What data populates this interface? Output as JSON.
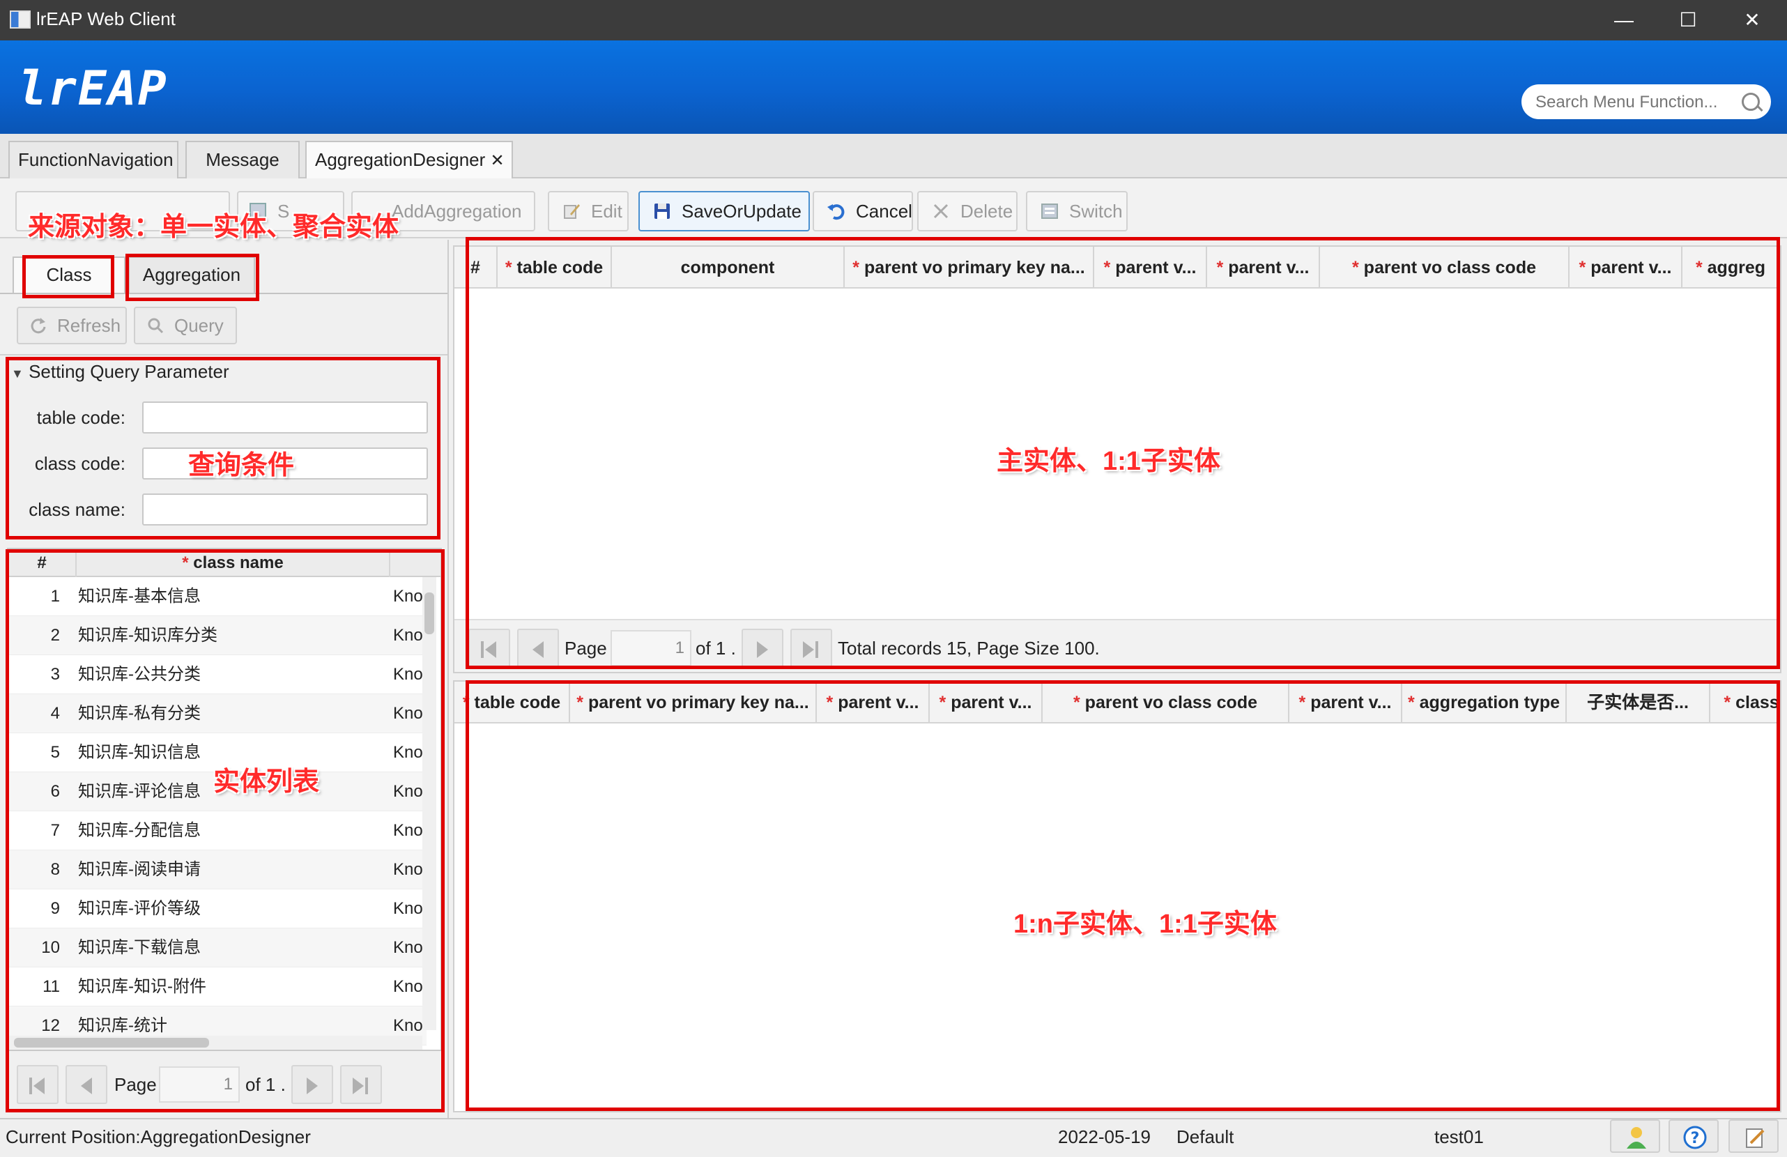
{
  "window": {
    "title": "lrEAP Web Client"
  },
  "header": {
    "logo": "lrEAP",
    "search_placeholder": "Search Menu Function..."
  },
  "main_tabs": [
    {
      "label": "FunctionNavigation"
    },
    {
      "label": "Message"
    },
    {
      "label": "AggregationDesigner",
      "close": "✕"
    }
  ],
  "toolbar": {
    "buttons": [
      {
        "label": "AddAggregation",
        "icon": "add-icon"
      },
      {
        "label": "Edit",
        "icon": "edit-icon"
      },
      {
        "label": "SaveOrUpdate",
        "icon": "save-icon"
      },
      {
        "label": "Cancel",
        "icon": "undo-icon"
      },
      {
        "label": "Delete",
        "icon": "delete-icon"
      },
      {
        "label": "Switch",
        "icon": "switch-icon"
      }
    ],
    "partial_label": "S"
  },
  "left": {
    "tabs": [
      "Class",
      "Aggregation"
    ],
    "refresh": "Refresh",
    "query": "Query",
    "query_title": "Setting Query Parameter",
    "fields": [
      {
        "label": "table code:",
        "value": ""
      },
      {
        "label": "class code:",
        "value": ""
      },
      {
        "label": "class name:",
        "value": ""
      }
    ],
    "table": {
      "headers": [
        "#",
        "class name"
      ],
      "rows": [
        {
          "n": "1",
          "name": "知识库-基本信息",
          "code": "Kno"
        },
        {
          "n": "2",
          "name": "知识库-知识库分类",
          "code": "Kno"
        },
        {
          "n": "3",
          "name": "知识库-公共分类",
          "code": "Kno"
        },
        {
          "n": "4",
          "name": "知识库-私有分类",
          "code": "Kno"
        },
        {
          "n": "5",
          "name": "知识库-知识信息",
          "code": "Kno"
        },
        {
          "n": "6",
          "name": "知识库-评论信息",
          "code": "Kno"
        },
        {
          "n": "7",
          "name": "知识库-分配信息",
          "code": "Kno"
        },
        {
          "n": "8",
          "name": "知识库-阅读申请",
          "code": "Kno"
        },
        {
          "n": "9",
          "name": "知识库-评价等级",
          "code": "Kno"
        },
        {
          "n": "10",
          "name": "知识库-下载信息",
          "code": "Kno"
        },
        {
          "n": "11",
          "name": "知识库-知识-附件",
          "code": "Kno"
        },
        {
          "n": "12",
          "name": "知识库-统计",
          "code": "Kno"
        }
      ]
    },
    "pager": {
      "page_label": "Page",
      "page_value": "1",
      "of_label": "of 1 ."
    }
  },
  "top_grid": {
    "headers": [
      "#",
      "* table code",
      "component",
      "* parent vo primary key na...",
      "* parent v...",
      "* parent v...",
      "* parent vo class code",
      "* parent v...",
      "* aggreg"
    ],
    "pager": {
      "page_label": "Page",
      "page_value": "1",
      "of_label": "of 1 .",
      "total": "Total records  15, Page Size 100."
    }
  },
  "bottom_grid": {
    "headers": [
      "* table code",
      "* parent vo primary key na...",
      "* parent v...",
      "* parent v...",
      "* parent vo class code",
      "* parent v...",
      "* aggregation type",
      "子实体是否...",
      "* class"
    ]
  },
  "status": {
    "position": "Current Position:AggregationDesigner",
    "date": "2022-05-19",
    "profile": "Default",
    "user": "test01"
  },
  "annotations": {
    "source": "来源对象：单一实体、聚合实体",
    "query": "查询条件",
    "list": "实体列表",
    "main": "主实体、1:1子实体",
    "sub": "1:n子实体、1:1子实体"
  },
  "colors": {
    "header_blue": "#0a66d6",
    "annotation_red": "#e00000",
    "required_star": "#e03030"
  }
}
